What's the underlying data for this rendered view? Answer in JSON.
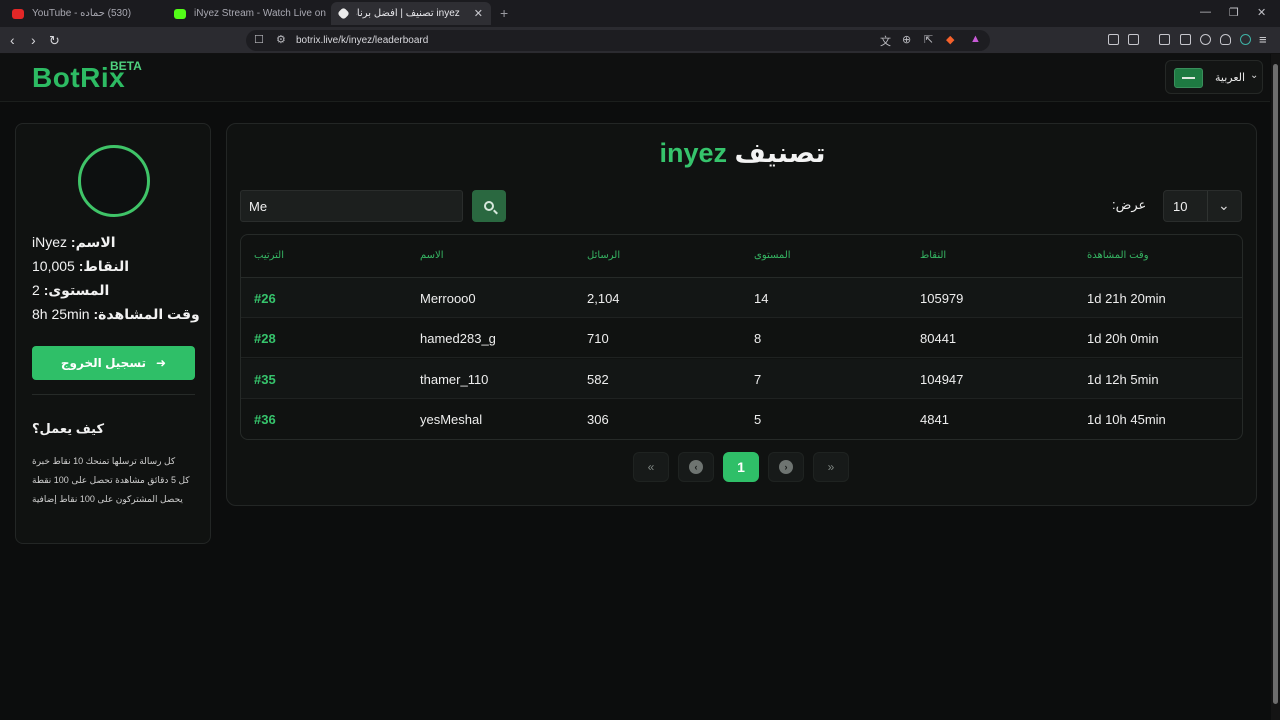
{
  "browser": {
    "tabs": [
      {
        "title": "(530) حماده - YouTube",
        "color": "#e22727"
      },
      {
        "title": "iNyez Stream - Watch Live on Kick",
        "color": "#53fc18"
      },
      {
        "title": "inyez تصنيف | أفضل برنامج لتعزيز",
        "color": "#eaeaea"
      }
    ],
    "new_tab": "+",
    "url": "botrix.live/k/inyez/leaderboard"
  },
  "header": {
    "logo": "BotRix",
    "badge": "BETA",
    "language": "العربية"
  },
  "sidebar": {
    "name_label": "الاسم:",
    "name_value": "iNyez",
    "points_label": "النقاط:",
    "points_value": "10,005",
    "level_label": "المستوى:",
    "level_value": "2",
    "watch_label": "وقت المشاهدة:",
    "watch_value": "8h 25min",
    "logout_label": "تسجيل الخروج",
    "how_title": "كيف يعمل؟",
    "how_lines": [
      "كل رسالة ترسلها تمنحك 10 نقاط خبرة",
      "كل 5 دقائق مشاهدة تحصل على 100 نقطة",
      "يحصل المشتركون على 100 نقاط إضافية"
    ]
  },
  "leaderboard": {
    "title_word": "تصنيف",
    "channel": "inyez",
    "search_value": "Me",
    "show_label": "عرض:",
    "page_size": "10",
    "columns": [
      "الترتيب",
      "الاسم",
      "الرسائل",
      "المستوى",
      "النقاط",
      "وقت المشاهدة"
    ],
    "rows": [
      {
        "rank": "#26",
        "name": "Merrooo0",
        "messages": "2,104",
        "level": "14",
        "points": "105979",
        "watchtime": "1d 21h 20min"
      },
      {
        "rank": "#28",
        "name": "hamed283_g",
        "messages": "710",
        "level": "8",
        "points": "80441",
        "watchtime": "1d 20h 0min"
      },
      {
        "rank": "#35",
        "name": "thamer_110",
        "messages": "582",
        "level": "7",
        "points": "104947",
        "watchtime": "1d 12h 5min"
      },
      {
        "rank": "#36",
        "name": "yesMeshal",
        "messages": "306",
        "level": "5",
        "points": "4841",
        "watchtime": "1d 10h 45min"
      }
    ],
    "current_page": "1"
  }
}
